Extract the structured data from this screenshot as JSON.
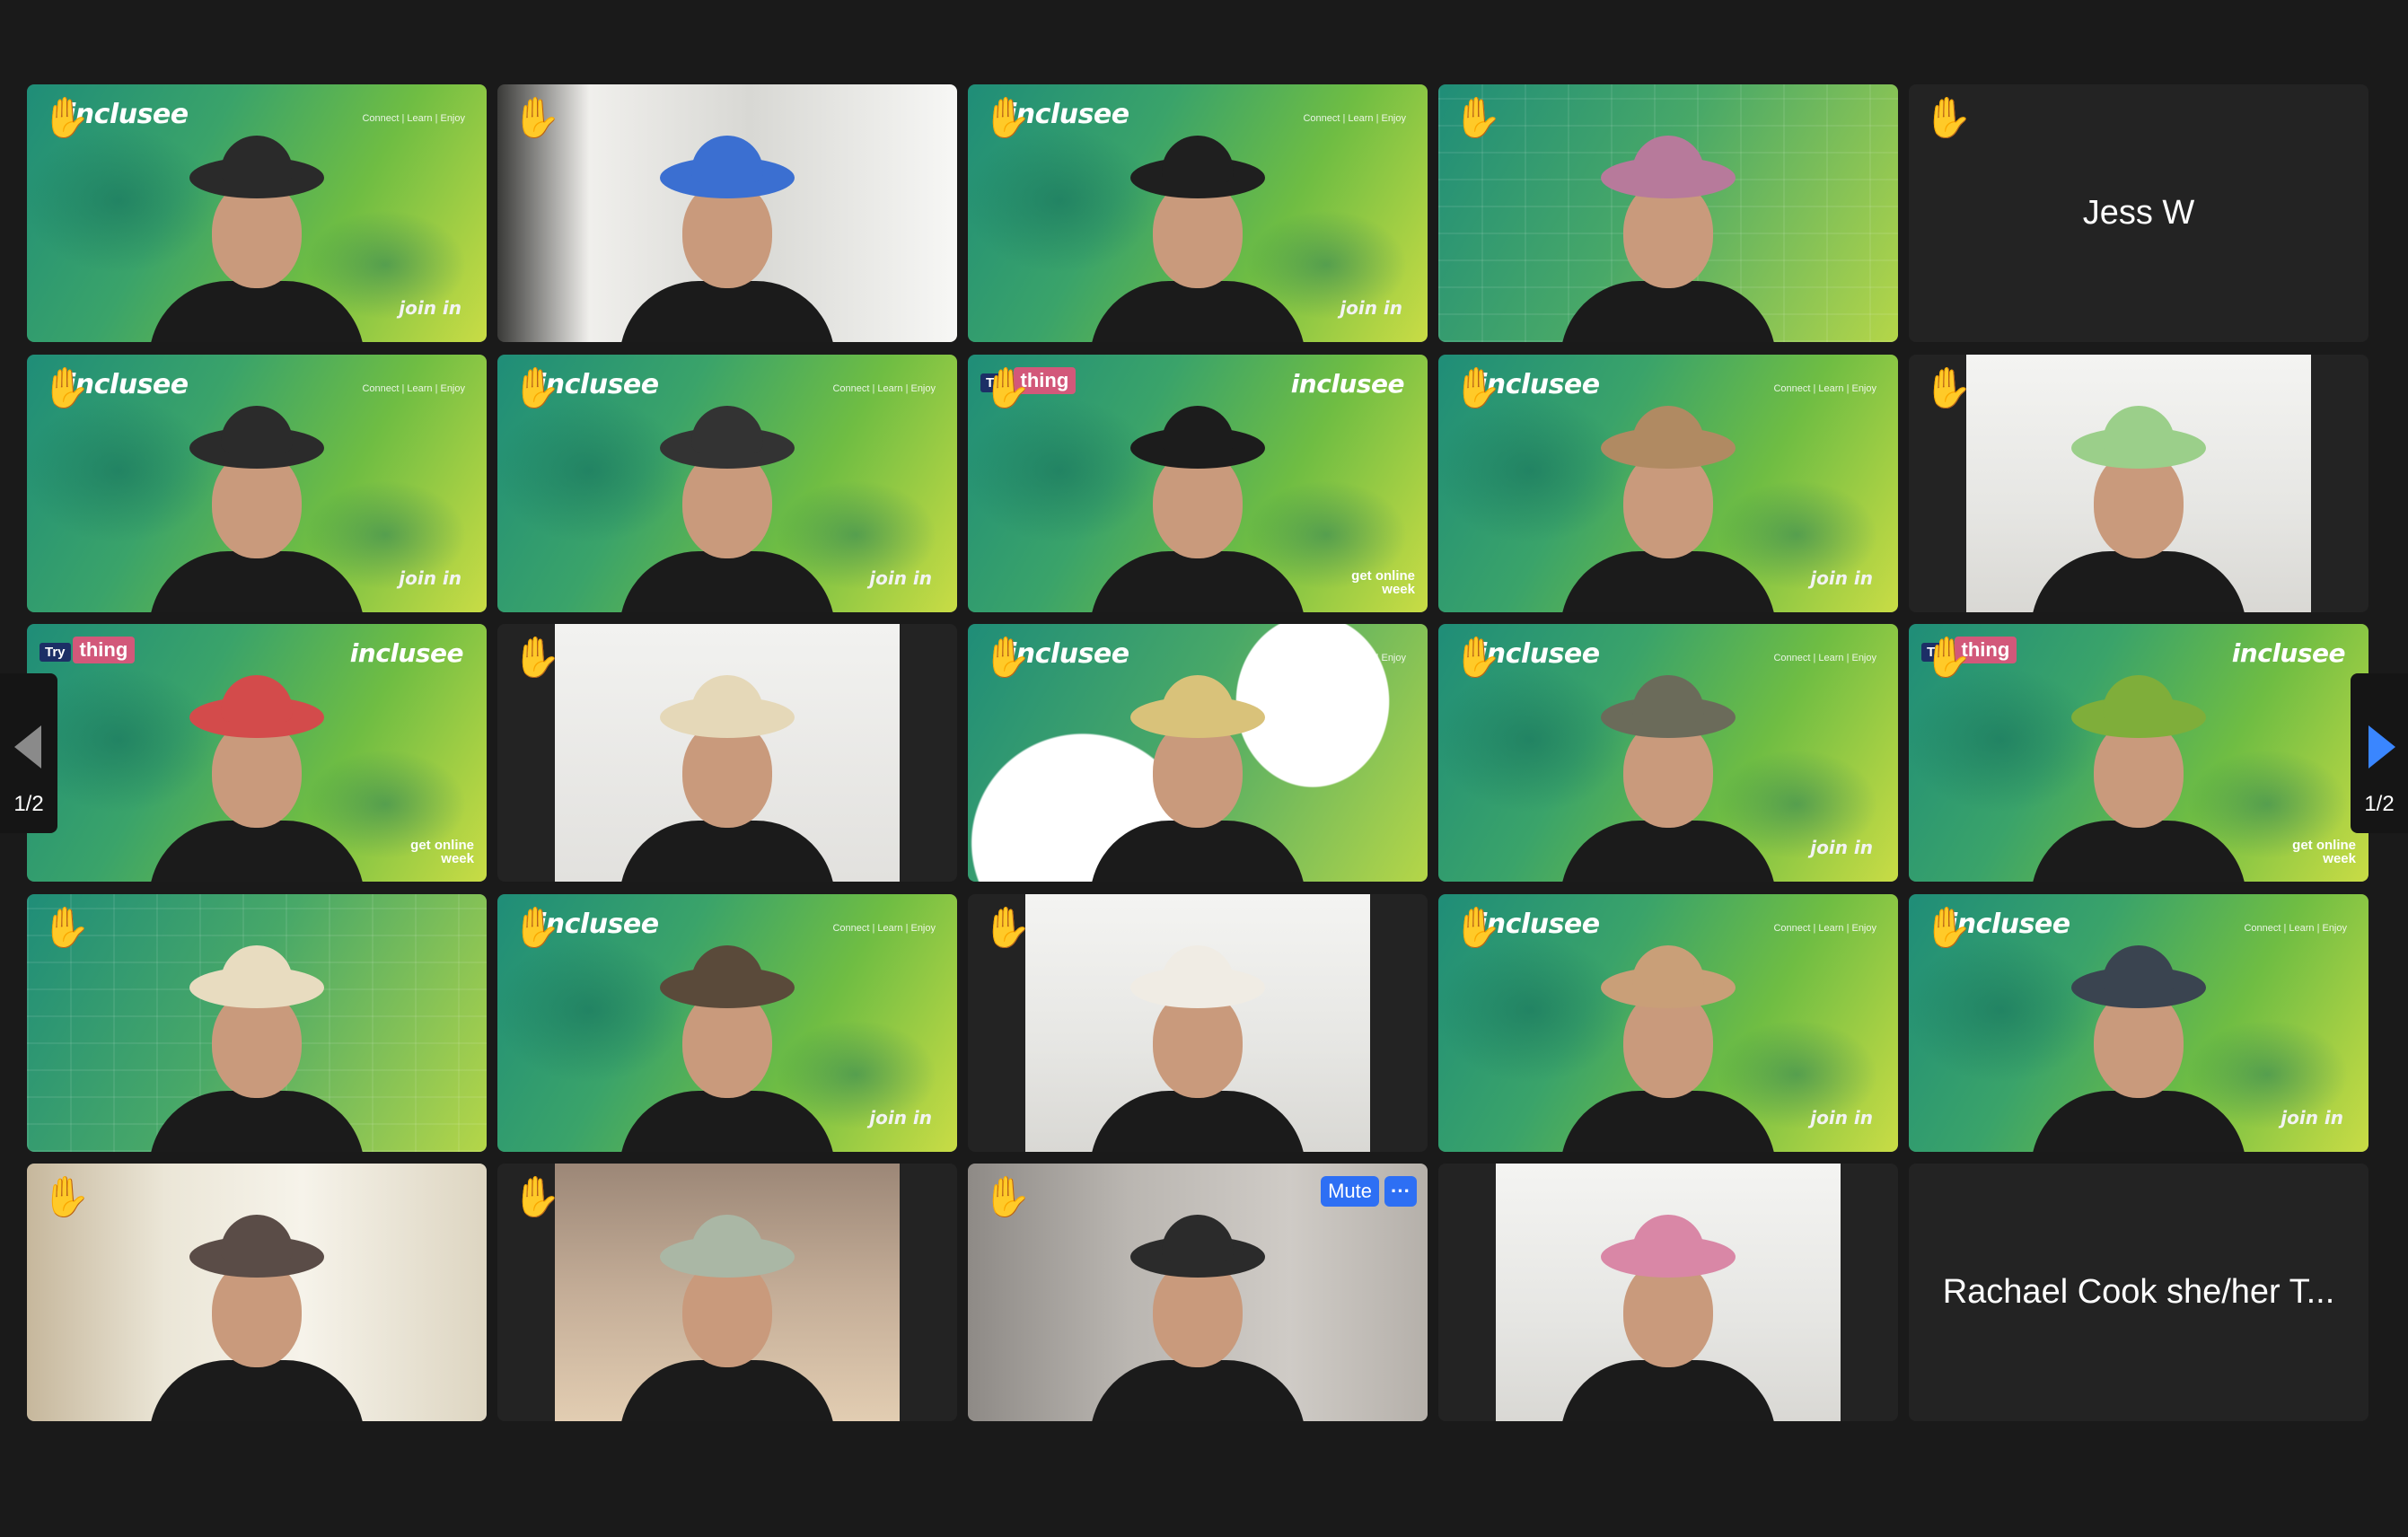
{
  "tiles": [
    {
      "row": 1,
      "col": 1,
      "bg": "inclusee",
      "brand": "inclusee",
      "tagline": "Connect | Learn | Enjoy",
      "footer": "join in",
      "hand": true,
      "hat": "#2a2a2a"
    },
    {
      "row": 1,
      "col": 2,
      "bg": "room-window",
      "hand": true,
      "hat": "#3b6fd1"
    },
    {
      "row": 1,
      "col": 3,
      "bg": "inclusee",
      "brand": "inclusee",
      "tagline": "Connect | Learn | Enjoy",
      "footer": "join in",
      "hand": true,
      "hat": "#1f1f1f"
    },
    {
      "row": 1,
      "col": 4,
      "bg": "pattern",
      "hand": true,
      "hat": "#b77a9b"
    },
    {
      "row": 1,
      "col": 5,
      "name": "Jess W",
      "hand": true
    },
    {
      "row": 2,
      "col": 1,
      "bg": "inclusee",
      "brand": "inclusee",
      "tagline": "Connect | Learn | Enjoy",
      "footer": "join in",
      "hand": true,
      "hat": "#2b2b2b"
    },
    {
      "row": 2,
      "col": 2,
      "bg": "inclusee",
      "brand": "inclusee",
      "tagline": "Connect | Learn | Enjoy",
      "footer": "join in",
      "hand": true,
      "hat": "#333333"
    },
    {
      "row": 2,
      "col": 3,
      "bg": "inclusee",
      "brand": "inclusee",
      "try": "Try",
      "thing": "thing",
      "getonline": "get online week",
      "hand": true,
      "hat": "#1c1c1c"
    },
    {
      "row": 2,
      "col": 4,
      "bg": "inclusee",
      "brand": "inclusee",
      "tagline": "Connect | Learn | Enjoy",
      "footer": "join in",
      "hand": true,
      "hat": "#b08a62"
    },
    {
      "row": 2,
      "col": 5,
      "bg": "room-white",
      "narrow": true,
      "hand": true,
      "hat": "#9bcf8a"
    },
    {
      "row": 3,
      "col": 1,
      "bg": "inclusee",
      "brand": "inclusee",
      "try": "Try",
      "thing": "thing",
      "getonline": "get online week",
      "hat": "#d34b4b"
    },
    {
      "row": 3,
      "col": 2,
      "bg": "room-light",
      "narrow": true,
      "hand": true,
      "hat": "#e5d8b8"
    },
    {
      "row": 3,
      "col": 3,
      "bg": "white-wave",
      "brand": "inclusee",
      "tagline": "Connect | Learn | Enjoy",
      "hand": true,
      "hat": "#d9c27a"
    },
    {
      "row": 3,
      "col": 4,
      "bg": "inclusee",
      "brand": "inclusee",
      "tagline": "Connect | Learn | Enjoy",
      "footer": "join in",
      "hand": true,
      "hat": "#6b6b5a"
    },
    {
      "row": 3,
      "col": 5,
      "bg": "inclusee",
      "brand": "inclusee",
      "try": "Try",
      "thing": "thing",
      "getonline": "get online week",
      "hand": true,
      "hat": "#7fae3a"
    },
    {
      "row": 4,
      "col": 1,
      "bg": "pattern",
      "hand": true,
      "hat": "#e8dcc0"
    },
    {
      "row": 4,
      "col": 2,
      "bg": "inclusee",
      "brand": "inclusee",
      "tagline": "Connect | Learn | Enjoy",
      "footer": "join in",
      "hand": true,
      "hat": "#5a4a3a"
    },
    {
      "row": 4,
      "col": 3,
      "bg": "room-white",
      "narrow": true,
      "hand": true,
      "hat": "#f0ece4"
    },
    {
      "row": 4,
      "col": 4,
      "bg": "inclusee",
      "brand": "inclusee",
      "tagline": "Connect | Learn | Enjoy",
      "footer": "join in",
      "hand": true,
      "hat": "#c99f78"
    },
    {
      "row": 4,
      "col": 5,
      "bg": "inclusee",
      "brand": "inclusee",
      "tagline": "Connect | Learn | Enjoy",
      "footer": "join in",
      "hand": true,
      "hat": "#3a4450"
    },
    {
      "row": 5,
      "col": 1,
      "bg": "room-cream",
      "hand": true,
      "hat": "#5a4c47"
    },
    {
      "row": 5,
      "col": 2,
      "bg": "room-warm",
      "narrow": true,
      "hand": true,
      "hat": "#aab7a5"
    },
    {
      "row": 5,
      "col": 3,
      "bg": "room-grey",
      "hand": true,
      "mute": "Mute",
      "more": "···"
    },
    {
      "row": 5,
      "col": 4,
      "bg": "room-white",
      "narrow": true,
      "hat": "#d987a6"
    },
    {
      "row": 5,
      "col": 5,
      "name": "Rachael Cook she/her T..."
    }
  ],
  "pagination": {
    "left_page": "1/2",
    "right_page": "1/2"
  },
  "colors": {
    "page_bg": "#1a1a1a",
    "tile_bg": "#232323",
    "accent_blue": "#2d6ff4",
    "next_arrow": "#3a86ff"
  }
}
